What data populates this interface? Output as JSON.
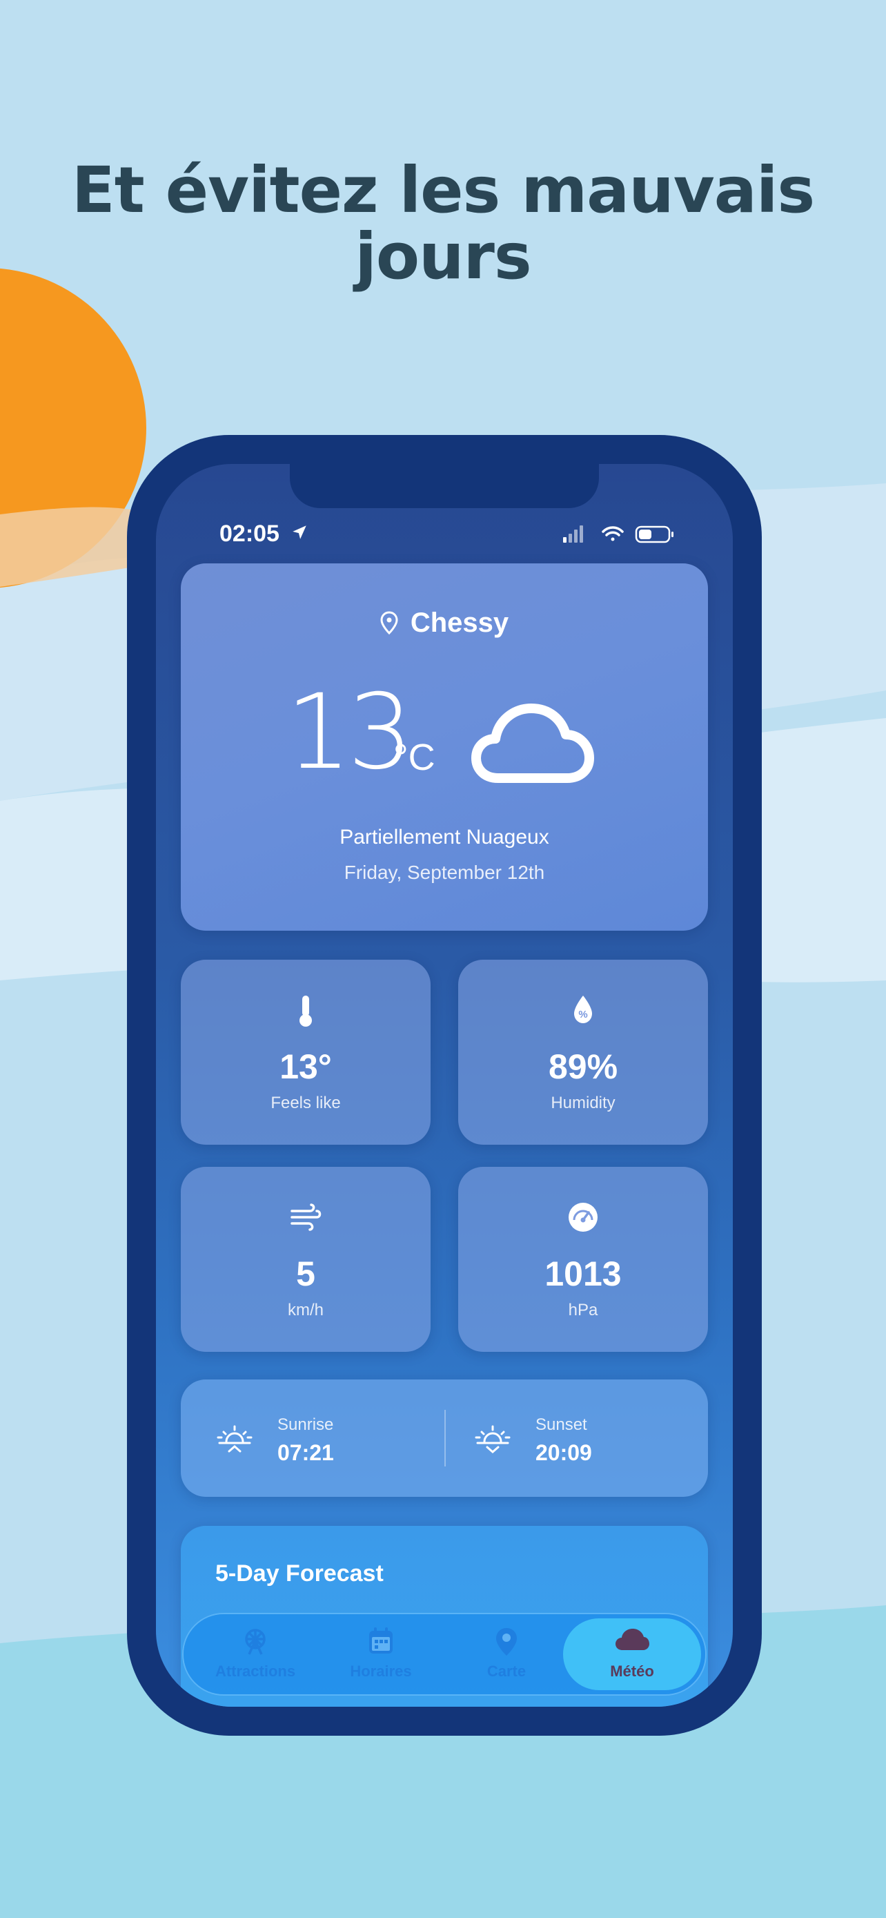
{
  "headline": {
    "line1": "Et évitez les mauvais",
    "line2": "jours"
  },
  "colors": {
    "background": "#bddff1",
    "phone_frame": "#133579",
    "headline": "#2a4655",
    "sun": "#f6981f",
    "active_tab": "#40c0f7"
  },
  "status_bar": {
    "time": "02:05",
    "icons": [
      "location-arrow-icon",
      "cellular-signal-icon",
      "wifi-icon",
      "battery-icon"
    ]
  },
  "weather": {
    "location": "Chessy",
    "temperature": "13",
    "unit": "°C",
    "condition": "Partiellement Nuageux",
    "date": "Friday, September 12th",
    "condition_icon": "cloud-icon"
  },
  "stats": [
    {
      "icon": "thermometer-icon",
      "value": "13°",
      "label": "Feels like"
    },
    {
      "icon": "humidity-drop-icon",
      "value": "89%",
      "label": "Humidity"
    },
    {
      "icon": "wind-icon",
      "value": "5",
      "label": "km/h"
    },
    {
      "icon": "pressure-gauge-icon",
      "value": "1013",
      "label": "hPa"
    }
  ],
  "sun": {
    "sunrise_label": "Sunrise",
    "sunrise_time": "07:21",
    "sunset_label": "Sunset",
    "sunset_time": "20:09"
  },
  "forecast": {
    "title": "5-Day Forecast"
  },
  "tabs": [
    {
      "label": "Attractions",
      "icon": "ferris-wheel-icon",
      "active": false
    },
    {
      "label": "Horaires",
      "icon": "calendar-icon",
      "active": false
    },
    {
      "label": "Carte",
      "icon": "map-pin-icon",
      "active": false
    },
    {
      "label": "Météo",
      "icon": "cloud-icon",
      "active": true
    }
  ]
}
